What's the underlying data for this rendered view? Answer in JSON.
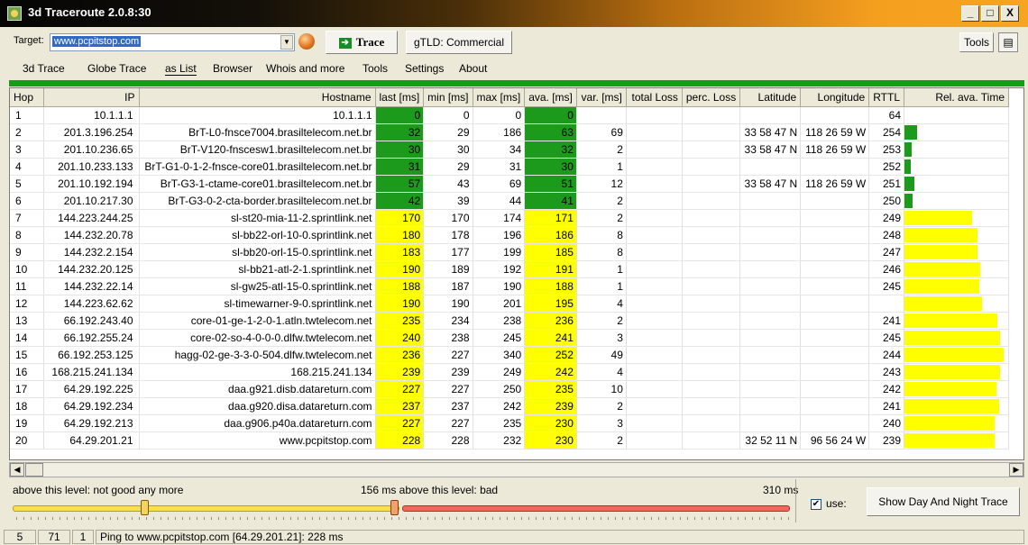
{
  "window": {
    "title": "3d Traceroute 2.0.8:30",
    "controls": [
      "_",
      "□",
      "X"
    ]
  },
  "toolbar": {
    "target_label": "Target:",
    "target_value": "www.pcpitstop.com",
    "trace_label": "Trace",
    "gtld_label": "gTLD: Commercial",
    "tools_label": "Tools"
  },
  "menu": [
    "3d Trace",
    "Globe Trace",
    "as List",
    "Browser",
    "Whois and more",
    "Tools",
    "Settings",
    "About"
  ],
  "active_tab": "as List",
  "table": {
    "columns": [
      "Hop",
      "IP",
      "Hostname",
      "last [ms]",
      "min [ms]",
      "max [ms]",
      "ava. [ms]",
      "var. [ms]",
      "total Loss",
      "perc. Loss",
      "Latitude",
      "Longitude",
      "RTTL",
      "Rel. ava. Time"
    ],
    "rows": [
      {
        "hop": "1",
        "ip": "10.1.1.1",
        "host": "10.1.1.1",
        "last": "0",
        "min": "0",
        "max": "0",
        "ava": "0",
        "var": "",
        "lat": "",
        "lon": "",
        "rttl": "64",
        "rel": 0.0,
        "color": "green"
      },
      {
        "hop": "2",
        "ip": "201.3.196.254",
        "host": "BrT-L0-fnsce7004.brasiltelecom.net.br",
        "last": "32",
        "min": "29",
        "max": "186",
        "ava": "63",
        "var": "69",
        "lat": "33 58 47 N",
        "lon": "118 26 59 W",
        "rttl": "254",
        "rel": 0.13,
        "color": "green"
      },
      {
        "hop": "3",
        "ip": "201.10.236.65",
        "host": "BrT-V120-fnscesw1.brasiltelecom.net.br",
        "last": "30",
        "min": "30",
        "max": "34",
        "ava": "32",
        "var": "2",
        "lat": "33 58 47 N",
        "lon": "118 26 59 W",
        "rttl": "253",
        "rel": 0.07,
        "color": "green"
      },
      {
        "hop": "4",
        "ip": "201.10.233.133",
        "host": "BrT-G1-0-1-2-fnsce-core01.brasiltelecom.net.br",
        "last": "31",
        "min": "29",
        "max": "31",
        "ava": "30",
        "var": "1",
        "lat": "",
        "lon": "",
        "rttl": "252",
        "rel": 0.06,
        "color": "green"
      },
      {
        "hop": "5",
        "ip": "201.10.192.194",
        "host": "BrT-G3-1-ctame-core01.brasiltelecom.net.br",
        "last": "57",
        "min": "43",
        "max": "69",
        "ava": "51",
        "var": "12",
        "lat": "33 58 47 N",
        "lon": "118 26 59 W",
        "rttl": "251",
        "rel": 0.1,
        "color": "green"
      },
      {
        "hop": "6",
        "ip": "201.10.217.30",
        "host": "BrT-G3-0-2-cta-border.brasiltelecom.net.br",
        "last": "42",
        "min": "39",
        "max": "44",
        "ava": "41",
        "var": "2",
        "lat": "",
        "lon": "",
        "rttl": "250",
        "rel": 0.08,
        "color": "green"
      },
      {
        "hop": "7",
        "ip": "144.223.244.25",
        "host": "sl-st20-mia-11-2.sprintlink.net",
        "last": "170",
        "min": "170",
        "max": "174",
        "ava": "171",
        "var": "2",
        "lat": "",
        "lon": "",
        "rttl": "249",
        "rel": 0.68,
        "color": "yellow"
      },
      {
        "hop": "8",
        "ip": "144.232.20.78",
        "host": "sl-bb22-orl-10-0.sprintlink.net",
        "last": "180",
        "min": "178",
        "max": "196",
        "ava": "186",
        "var": "8",
        "lat": "",
        "lon": "",
        "rttl": "248",
        "rel": 0.74,
        "color": "yellow"
      },
      {
        "hop": "9",
        "ip": "144.232.2.154",
        "host": "sl-bb20-orl-15-0.sprintlink.net",
        "last": "183",
        "min": "177",
        "max": "199",
        "ava": "185",
        "var": "8",
        "lat": "",
        "lon": "",
        "rttl": "247",
        "rel": 0.74,
        "color": "yellow"
      },
      {
        "hop": "10",
        "ip": "144.232.20.125",
        "host": "sl-bb21-atl-2-1.sprintlink.net",
        "last": "190",
        "min": "189",
        "max": "192",
        "ava": "191",
        "var": "1",
        "lat": "",
        "lon": "",
        "rttl": "246",
        "rel": 0.76,
        "color": "yellow"
      },
      {
        "hop": "11",
        "ip": "144.232.22.14",
        "host": "sl-gw25-atl-15-0.sprintlink.net",
        "last": "188",
        "min": "187",
        "max": "190",
        "ava": "188",
        "var": "1",
        "lat": "",
        "lon": "",
        "rttl": "245",
        "rel": 0.75,
        "color": "yellow"
      },
      {
        "hop": "12",
        "ip": "144.223.62.62",
        "host": "sl-timewarner-9-0.sprintlink.net",
        "last": "190",
        "min": "190",
        "max": "201",
        "ava": "195",
        "var": "4",
        "lat": "",
        "lon": "",
        "rttl": "",
        "rel": 0.78,
        "color": "yellow"
      },
      {
        "hop": "13",
        "ip": "66.192.243.40",
        "host": "core-01-ge-1-2-0-1.atln.twtelecom.net",
        "last": "235",
        "min": "234",
        "max": "238",
        "ava": "236",
        "var": "2",
        "lat": "",
        "lon": "",
        "rttl": "241",
        "rel": 0.94,
        "color": "yellow"
      },
      {
        "hop": "14",
        "ip": "66.192.255.24",
        "host": "core-02-so-4-0-0-0.dlfw.twtelecom.net",
        "last": "240",
        "min": "238",
        "max": "245",
        "ava": "241",
        "var": "3",
        "lat": "",
        "lon": "",
        "rttl": "245",
        "rel": 0.96,
        "color": "yellow"
      },
      {
        "hop": "15",
        "ip": "66.192.253.125",
        "host": "hagg-02-ge-3-3-0-504.dlfw.twtelecom.net",
        "last": "236",
        "min": "227",
        "max": "340",
        "ava": "252",
        "var": "49",
        "lat": "",
        "lon": "",
        "rttl": "244",
        "rel": 1.0,
        "color": "yellow"
      },
      {
        "hop": "16",
        "ip": "168.215.241.134",
        "host": "168.215.241.134",
        "last": "239",
        "min": "239",
        "max": "249",
        "ava": "242",
        "var": "4",
        "lat": "",
        "lon": "",
        "rttl": "243",
        "rel": 0.96,
        "color": "yellow"
      },
      {
        "hop": "17",
        "ip": "64.29.192.225",
        "host": "daa.g921.disb.datareturn.com",
        "last": "227",
        "min": "227",
        "max": "250",
        "ava": "235",
        "var": "10",
        "lat": "",
        "lon": "",
        "rttl": "242",
        "rel": 0.93,
        "color": "yellow"
      },
      {
        "hop": "18",
        "ip": "64.29.192.234",
        "host": "daa.g920.disa.datareturn.com",
        "last": "237",
        "min": "237",
        "max": "242",
        "ava": "239",
        "var": "2",
        "lat": "",
        "lon": "",
        "rttl": "241",
        "rel": 0.95,
        "color": "yellow"
      },
      {
        "hop": "19",
        "ip": "64.29.192.213",
        "host": "daa.g906.p40a.datareturn.com",
        "last": "227",
        "min": "227",
        "max": "235",
        "ava": "230",
        "var": "3",
        "lat": "",
        "lon": "",
        "rttl": "240",
        "rel": 0.91,
        "color": "yellow"
      },
      {
        "hop": "20",
        "ip": "64.29.201.21",
        "host": "www.pcpitstop.com",
        "last": "228",
        "min": "228",
        "max": "232",
        "ava": "230",
        "var": "2",
        "lat": "32 52 11 N",
        "lon": "96 56 24 W",
        "rttl": "239",
        "rel": 0.91,
        "color": "yellow"
      }
    ]
  },
  "thresholds": {
    "good_label": "above this level: not good any more",
    "bad_label": "156 ms above this level: bad",
    "max_label": "310 ms",
    "use_label": "use:",
    "use_checked": true,
    "daynight_label": "Show Day And Night Trace",
    "good_level": 0.17,
    "bad_level": 0.33
  },
  "colors": {
    "green": "#1c9a1c",
    "yellow": "#ffff00"
  },
  "status": {
    "f1": "5",
    "f2": "71",
    "f3": "1",
    "message": "Ping to www.pcpitstop.com [64.29.201.21]: 228 ms"
  }
}
